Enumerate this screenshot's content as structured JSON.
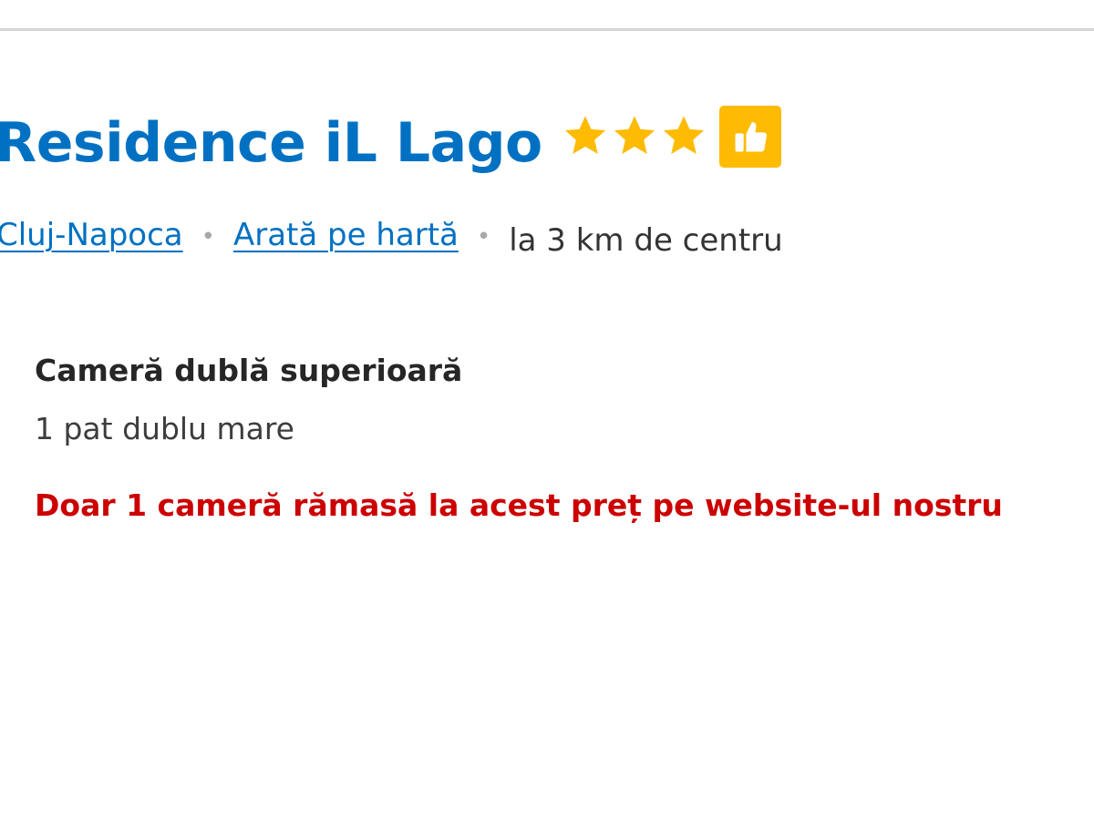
{
  "hotel": {
    "name": "Residence iL Lago",
    "star_count": 3,
    "star_color": "#febb02",
    "badge_icon": "thumbs-up-icon",
    "title_color": "#0071c2"
  },
  "location": {
    "city": "Cluj-Napoca",
    "map_link": "Arată pe hartă",
    "distance": "la 3 km de centru",
    "separator": "•"
  },
  "room": {
    "name": "Cameră dublă superioară",
    "bed": "1 pat dublu mare",
    "availability": "Doar 1 cameră rămasă la acest preț pe website-ul nostru",
    "availability_color": "#cc0000"
  }
}
